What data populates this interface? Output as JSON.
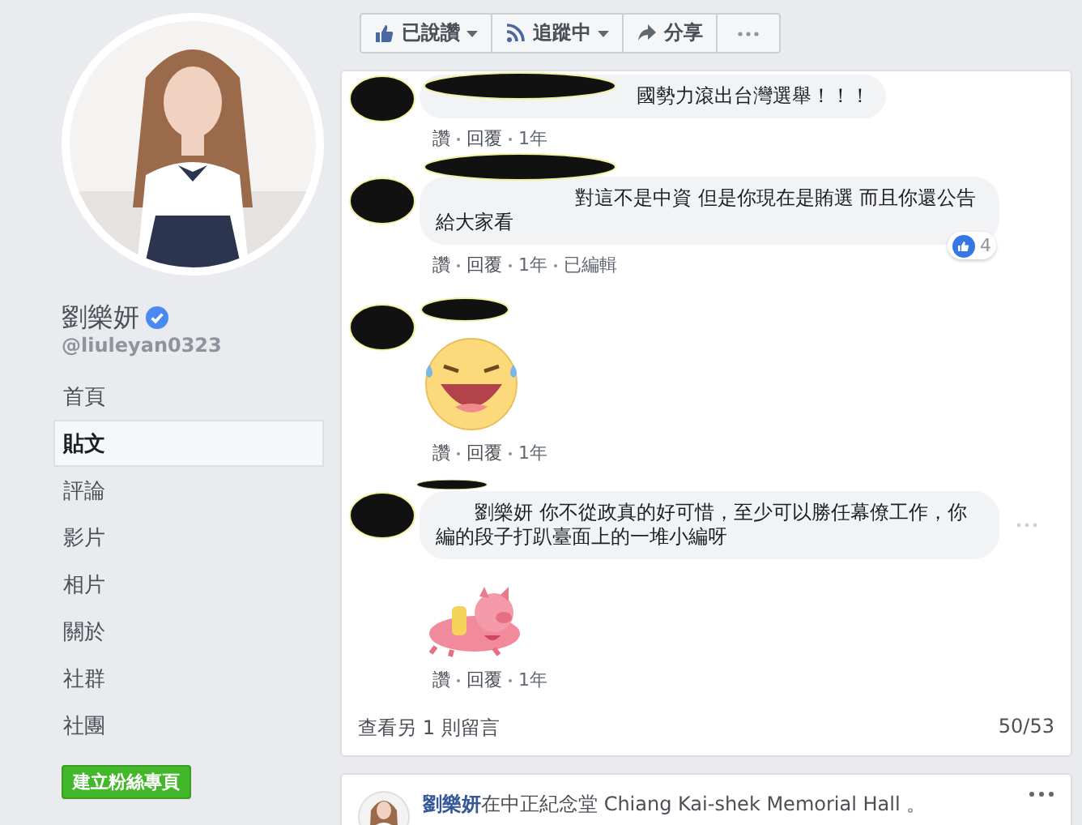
{
  "profile": {
    "name": "劉樂妍",
    "verified": true,
    "handle": "@liuleyan0323"
  },
  "nav": [
    {
      "label": "首頁",
      "selected": false
    },
    {
      "label": "貼文",
      "selected": true
    },
    {
      "label": "評論",
      "selected": false
    },
    {
      "label": "影片",
      "selected": false
    },
    {
      "label": "相片",
      "selected": false
    },
    {
      "label": "關於",
      "selected": false
    },
    {
      "label": "社群",
      "selected": false
    },
    {
      "label": "社團",
      "selected": false
    }
  ],
  "create_page_button": "建立粉絲專頁",
  "actions": [
    {
      "kind": "like",
      "label": "已說讚"
    },
    {
      "kind": "follow",
      "label": "追蹤中"
    },
    {
      "kind": "share",
      "label": "分享"
    },
    {
      "kind": "more"
    }
  ],
  "comments": [
    {
      "kind": "text",
      "text": "國勢力滾出台灣選舉！！！",
      "meta": [
        "讚",
        "回覆",
        "1年"
      ]
    },
    {
      "kind": "text",
      "text": "對這不是中資 但是你現在是賄選 而且你還公告給大家看",
      "reactions": "4",
      "meta": [
        "讚",
        "回覆",
        "1年",
        "已編輯"
      ]
    },
    {
      "kind": "laughsticker",
      "meta": [
        "讚",
        "回覆",
        "1年"
      ]
    },
    {
      "kind": "text",
      "text": "劉樂妍 你不從政真的好可惜，至少可以勝任幕僚工作，你編的段子打趴臺面上的一堆小編呀",
      "menu": true
    },
    {
      "kind": "pigreply",
      "meta": [
        "讚",
        "回覆",
        "1年"
      ]
    }
  ],
  "more_comments": "查看另 1 則留言",
  "comment_count": "50/53",
  "next_post": {
    "author": "劉樂妍",
    "text": "在中正紀念堂 Chiang Kai-shek Memorial Hall 。"
  }
}
